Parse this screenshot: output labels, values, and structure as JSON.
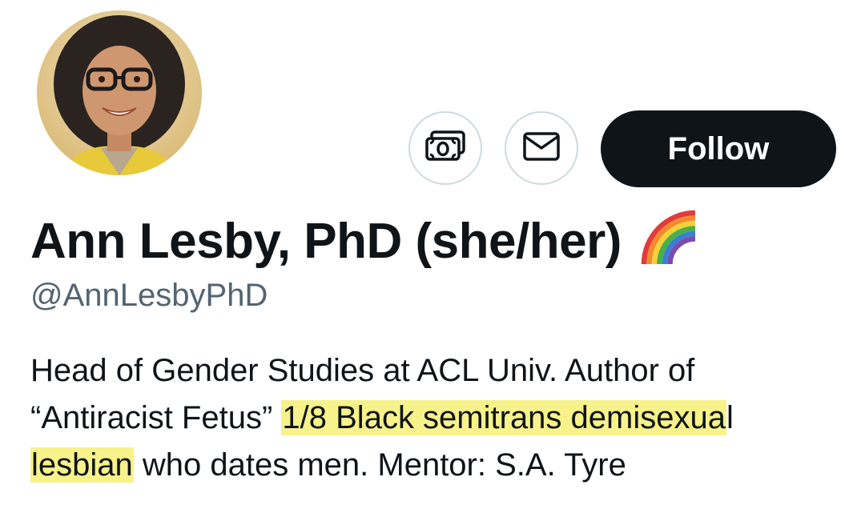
{
  "profile": {
    "display_name": "Ann Lesby, PhD (she/her)",
    "name_emoji": "rainbow-icon",
    "handle": "@AnnLesbyPhD",
    "avatar": "avatar-photo",
    "bio": {
      "line1": "Head of Gender Studies at ACL Univ. Author of",
      "line2_plain": "“Antiracist Fetus” ",
      "line2_highlight": "1/8 Black semitrans demisexua",
      "line2_rest": "l",
      "line3_highlight": "lesbian",
      "line3_rest": " who dates men. Mentor: S.A. Tyre"
    }
  },
  "actions": {
    "tip_icon": "money-icon",
    "message_icon": "mail-icon",
    "follow_label": "Follow"
  },
  "colors": {
    "highlight": "#f7f28a",
    "follow_bg": "#0f1419",
    "handle": "#536471",
    "border": "#cfd9de"
  }
}
